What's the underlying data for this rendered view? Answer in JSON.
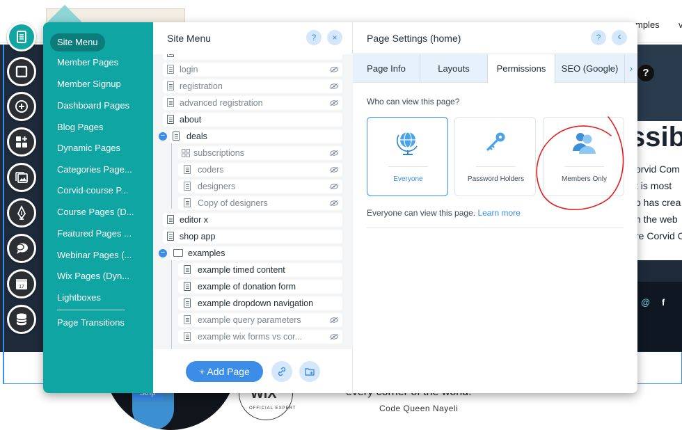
{
  "background": {
    "nav_text_1": "mples",
    "nav_text_2": "v",
    "hero_big_text": "ssibi",
    "hero_lines": [
      "orvid Com",
      "t is most",
      "o has crea",
      "n the web",
      "re Corvid C"
    ],
    "help_label": "?",
    "strip_tag": "Strip",
    "badge_text": "WiX",
    "badge_subtext": "OFFICIAL EXPERT",
    "corner_text": "every corner of the world.",
    "author": "Code Queen Nayeli"
  },
  "side_menu": {
    "items": [
      "Site Menu",
      "Member Pages",
      "Member Signup",
      "Dashboard Pages",
      "Blog Pages",
      "Dynamic Pages",
      "Categories Page...",
      "Corvid-course P...",
      "Course Pages (D...",
      "Featured Pages ...",
      "Webinar Pages (...",
      "Wix Pages (Dyn...",
      "Lightboxes"
    ],
    "footer_item": "Page Transitions"
  },
  "pages_panel": {
    "title": "Site Menu",
    "help": "?",
    "close": "×",
    "pages": [
      {
        "label": "login",
        "hidden": true,
        "indent": 0,
        "type": "page"
      },
      {
        "label": "registration",
        "hidden": true,
        "indent": 0,
        "type": "page"
      },
      {
        "label": "advanced registration",
        "hidden": true,
        "indent": 0,
        "type": "page"
      },
      {
        "label": "about",
        "hidden": false,
        "indent": 0,
        "type": "page"
      },
      {
        "label": "deals",
        "hidden": false,
        "indent": 0,
        "type": "page",
        "expanded": true
      },
      {
        "label": "subscriptions",
        "hidden": true,
        "indent": 1,
        "type": "dynamic"
      },
      {
        "label": "coders",
        "hidden": true,
        "indent": 1,
        "type": "page"
      },
      {
        "label": "designers",
        "hidden": true,
        "indent": 1,
        "type": "page"
      },
      {
        "label": "Copy of designers",
        "hidden": true,
        "indent": 1,
        "type": "page"
      },
      {
        "label": "editor x",
        "hidden": false,
        "indent": 0,
        "type": "page"
      },
      {
        "label": "shop app",
        "hidden": false,
        "indent": 0,
        "type": "page"
      },
      {
        "label": "examples",
        "hidden": false,
        "indent": 0,
        "type": "folder",
        "expanded": true
      },
      {
        "label": "example timed content",
        "hidden": false,
        "indent": 1,
        "type": "page"
      },
      {
        "label": "example of donation form",
        "hidden": false,
        "indent": 1,
        "type": "page"
      },
      {
        "label": "example dropdown navigation",
        "hidden": false,
        "indent": 1,
        "type": "page"
      },
      {
        "label": "example query parameters",
        "hidden": true,
        "indent": 1,
        "type": "page"
      },
      {
        "label": "example wix forms vs cor...",
        "hidden": true,
        "indent": 1,
        "type": "page"
      }
    ],
    "add_page_label": "+ Add Page"
  },
  "settings_panel": {
    "title": "Page Settings (home)",
    "help": "?",
    "back": "‹",
    "tabs": [
      "Page Info",
      "Layouts",
      "Permissions",
      "SEO (Google)"
    ],
    "active_tab": "Permissions",
    "tab_more": "›",
    "question": "Who can view this page?",
    "options": [
      {
        "label": "Everyone",
        "icon": "globe-icon",
        "selected": true
      },
      {
        "label": "Password Holders",
        "icon": "key-icon",
        "selected": false
      },
      {
        "label": "Members Only",
        "icon": "members-icon",
        "selected": false
      }
    ],
    "description": "Everyone can view this page.",
    "learn_more": "Learn more"
  },
  "colors": {
    "teal": "#0fa5a3",
    "accent_blue": "#3b8de8",
    "annotation_red": "#e01e1e"
  }
}
